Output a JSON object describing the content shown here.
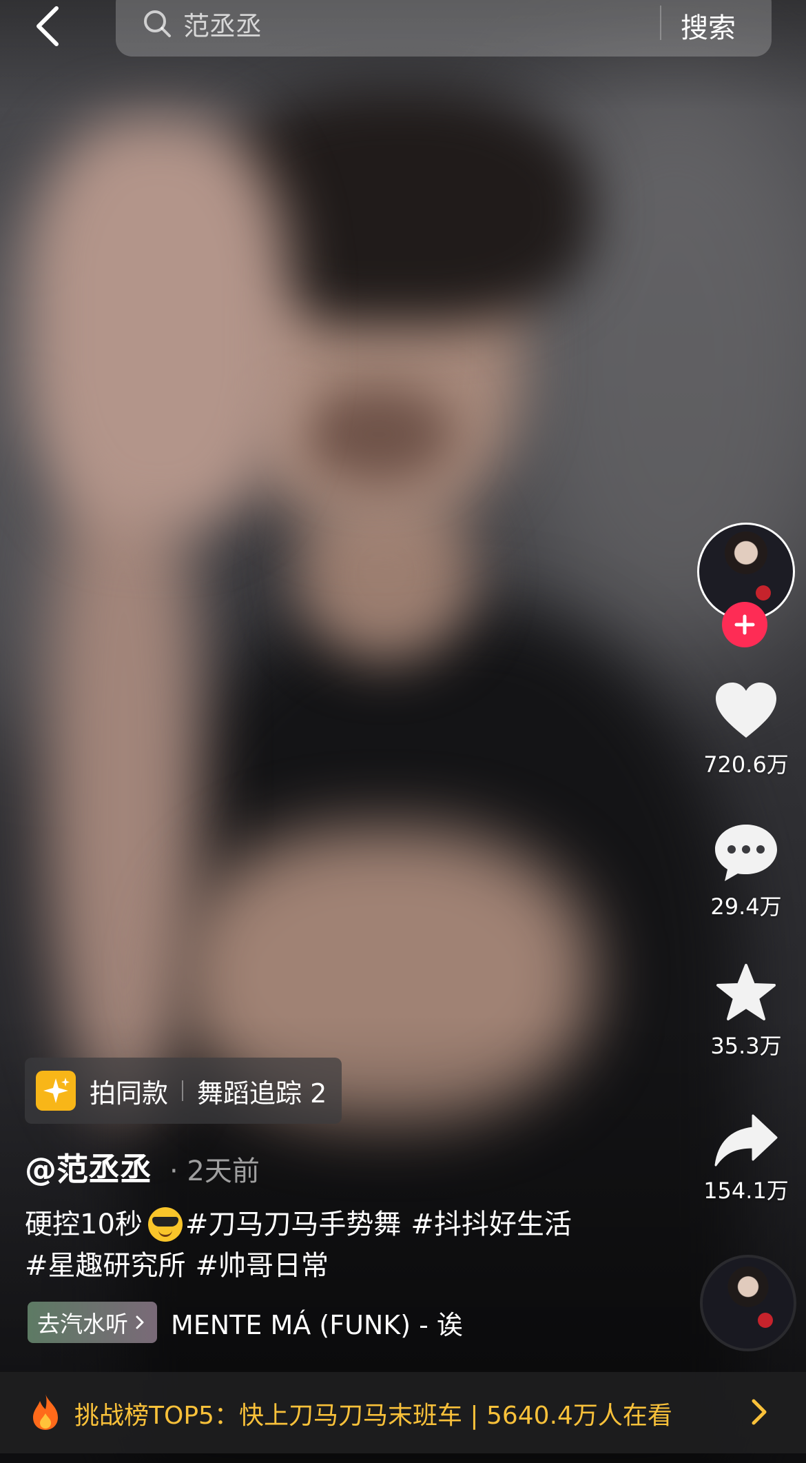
{
  "search": {
    "query": "范丞丞",
    "button_label": "搜索"
  },
  "icons": {
    "back": "chevron-left-icon",
    "search": "magnifier-icon",
    "like": "heart-icon",
    "comment": "speech-bubble-icon",
    "favorite": "star-icon",
    "share": "share-arrow-icon",
    "follow": "plus-icon",
    "template": "sparkle-icon",
    "challenge": "flame-icon"
  },
  "actions": {
    "likes": "720.6万",
    "comments": "29.4万",
    "favorites": "35.3万",
    "shares": "154.1万"
  },
  "template": {
    "label": "拍同款",
    "name": "舞蹈追踪 2"
  },
  "post": {
    "author": "@范丞丞",
    "time": "· 2天前",
    "caption_prefix": "硬控10秒",
    "hashtags_line1": [
      "#刀马刀马手势舞",
      "#抖抖好生活"
    ],
    "hashtags_line2": [
      "#星趣研究所",
      "#帅哥日常"
    ]
  },
  "music": {
    "source_label": "去汽水听",
    "title": "MENTE MÁ (FUNK) - 诶"
  },
  "challenge": {
    "text": "挑战榜TOP5：快上刀马刀马末班车 | 5640.4万人在看"
  },
  "colors": {
    "follow_accent": "#fe2c55",
    "challenge_text": "#f9c13a",
    "template_icon_bg": "#f8b618"
  }
}
